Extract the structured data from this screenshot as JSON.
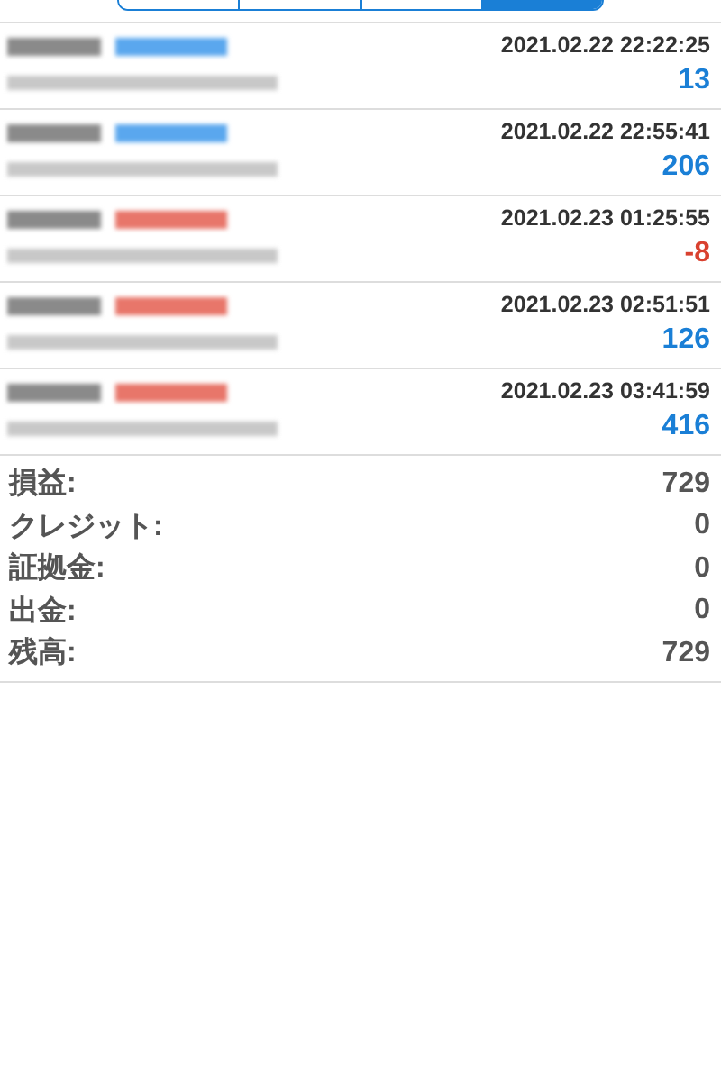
{
  "segments": [
    {
      "selected": false
    },
    {
      "selected": false
    },
    {
      "selected": false
    },
    {
      "selected": true
    }
  ],
  "trades": [
    {
      "kind": "buy",
      "time": "2021.02.22 22:22:25",
      "profit": "13",
      "loss": false
    },
    {
      "kind": "buy",
      "time": "2021.02.22 22:55:41",
      "profit": "206",
      "loss": false
    },
    {
      "kind": "sell",
      "time": "2021.02.23 01:25:55",
      "profit": "-8",
      "loss": true
    },
    {
      "kind": "sell",
      "time": "2021.02.23 02:51:51",
      "profit": "126",
      "loss": false
    },
    {
      "kind": "sell",
      "time": "2021.02.23 03:41:59",
      "profit": "416",
      "loss": false
    }
  ],
  "summary": [
    {
      "label": "損益:",
      "value": "729"
    },
    {
      "label": "クレジット:",
      "value": "0"
    },
    {
      "label": "証拠金:",
      "value": "0"
    },
    {
      "label": "出金:",
      "value": "0"
    },
    {
      "label": "残高:",
      "value": "729"
    }
  ]
}
